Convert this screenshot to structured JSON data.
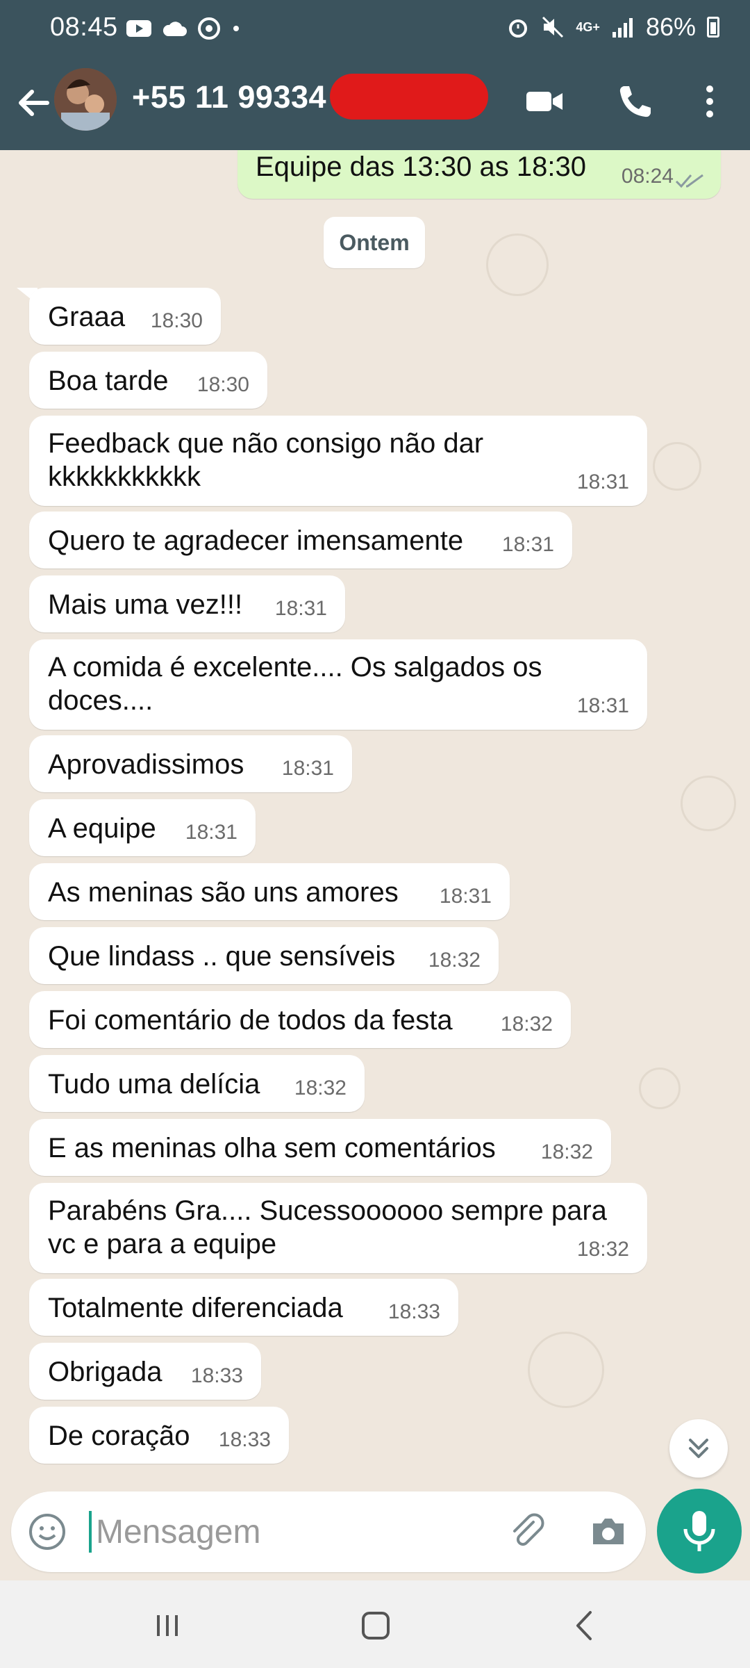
{
  "status_bar": {
    "time": "08:45",
    "battery": "86%",
    "network": "4G+"
  },
  "header": {
    "contact": "+55 11 99334",
    "icons": [
      "back-arrow-icon",
      "video-call-icon",
      "phone-icon",
      "more-options-icon"
    ]
  },
  "chat": {
    "outgoing_top": {
      "text": "Equipe das 13:30 as 18:30",
      "time": "08:24"
    },
    "date_divider": "Ontem",
    "messages": [
      {
        "text": "Graaa",
        "time": "18:30"
      },
      {
        "text": "Boa tarde",
        "time": "18:30"
      },
      {
        "text": "Feedback que não consigo não dar kkkkkkkkkkk",
        "line1": "Feedback que não consigo não dar",
        "line2": "kkkkkkkkkkk",
        "time": "18:31"
      },
      {
        "text": "Quero te agradecer imensamente",
        "time": "18:31"
      },
      {
        "text": "Mais uma vez!!!",
        "time": "18:31"
      },
      {
        "text": "A comida é excelente.... Os salgados os doces....",
        "line1": "A comida é excelente.... Os salgados os",
        "line2": "doces....",
        "time": "18:31"
      },
      {
        "text": "Aprovadissimos",
        "time": "18:31"
      },
      {
        "text": "A equipe",
        "time": "18:31"
      },
      {
        "text": "As meninas são uns amores",
        "time": "18:31"
      },
      {
        "text": "Que lindass .. que sensíveis",
        "time": "18:32"
      },
      {
        "text": "Foi comentário de todos da festa",
        "time": "18:32"
      },
      {
        "text": "Tudo uma delícia",
        "time": "18:32"
      },
      {
        "text": "E as meninas olha sem comentários",
        "time": "18:32"
      },
      {
        "text": "Parabéns Gra.... Sucessoooooo sempre para vc e para a equipe",
        "line1": "Parabéns Gra.... Sucessoooooo sempre para",
        "line2": "vc e para a equipe",
        "time": "18:32"
      },
      {
        "text": "Totalmente diferenciada",
        "time": "18:33"
      },
      {
        "text": "Obrigada",
        "time": "18:33"
      },
      {
        "text": "De coração",
        "time": "18:33"
      }
    ]
  },
  "composer": {
    "placeholder": "Mensagem"
  },
  "colors": {
    "header": "#3b535d",
    "chat_bg": "#efe7dd",
    "outgoing_bubble": "#dcf8c6",
    "accent": "#1aa38c"
  }
}
